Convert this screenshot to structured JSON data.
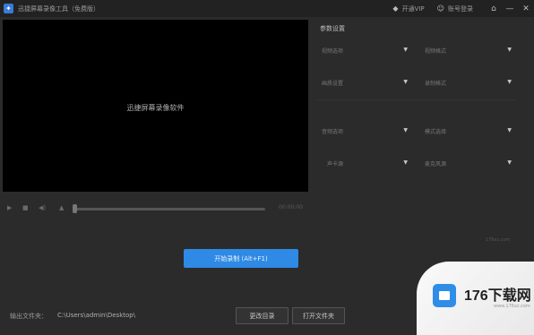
{
  "titlebar": {
    "app_title": "迅捷屏幕录像工具（免费版）",
    "action_register": "开通VIP",
    "action_login": "账号登录",
    "icon_names": [
      "app-icon",
      "diamond-icon",
      "user-icon",
      "home-icon",
      "minimize-icon",
      "close-icon"
    ]
  },
  "preview": {
    "placeholder": "迅捷屏幕录像软件",
    "time": "00:00:00"
  },
  "settings": {
    "title": "参数设置",
    "fields": [
      {
        "label": "视频选项",
        "value": ""
      },
      {
        "label": "视频格式",
        "value": ""
      },
      {
        "label": "画质设置",
        "value": ""
      },
      {
        "label": "录制格式",
        "value": ""
      },
      {
        "label": "音频选项",
        "value": ""
      },
      {
        "label": "模式选择",
        "value": ""
      },
      {
        "label": "声卡源",
        "value": ""
      },
      {
        "label": "麦克风源",
        "value": ""
      }
    ]
  },
  "record_button": "开始录制 (Alt+F1)",
  "output": {
    "label": "输出文件夹：",
    "path": "C:\\Users\\admin\\Desktop\\",
    "change_button": "更改目录",
    "open_button": "打开文件夹"
  },
  "watermark": {
    "text": "176下载网",
    "sub": "www.176xz.com",
    "faint": "176xz.com"
  }
}
